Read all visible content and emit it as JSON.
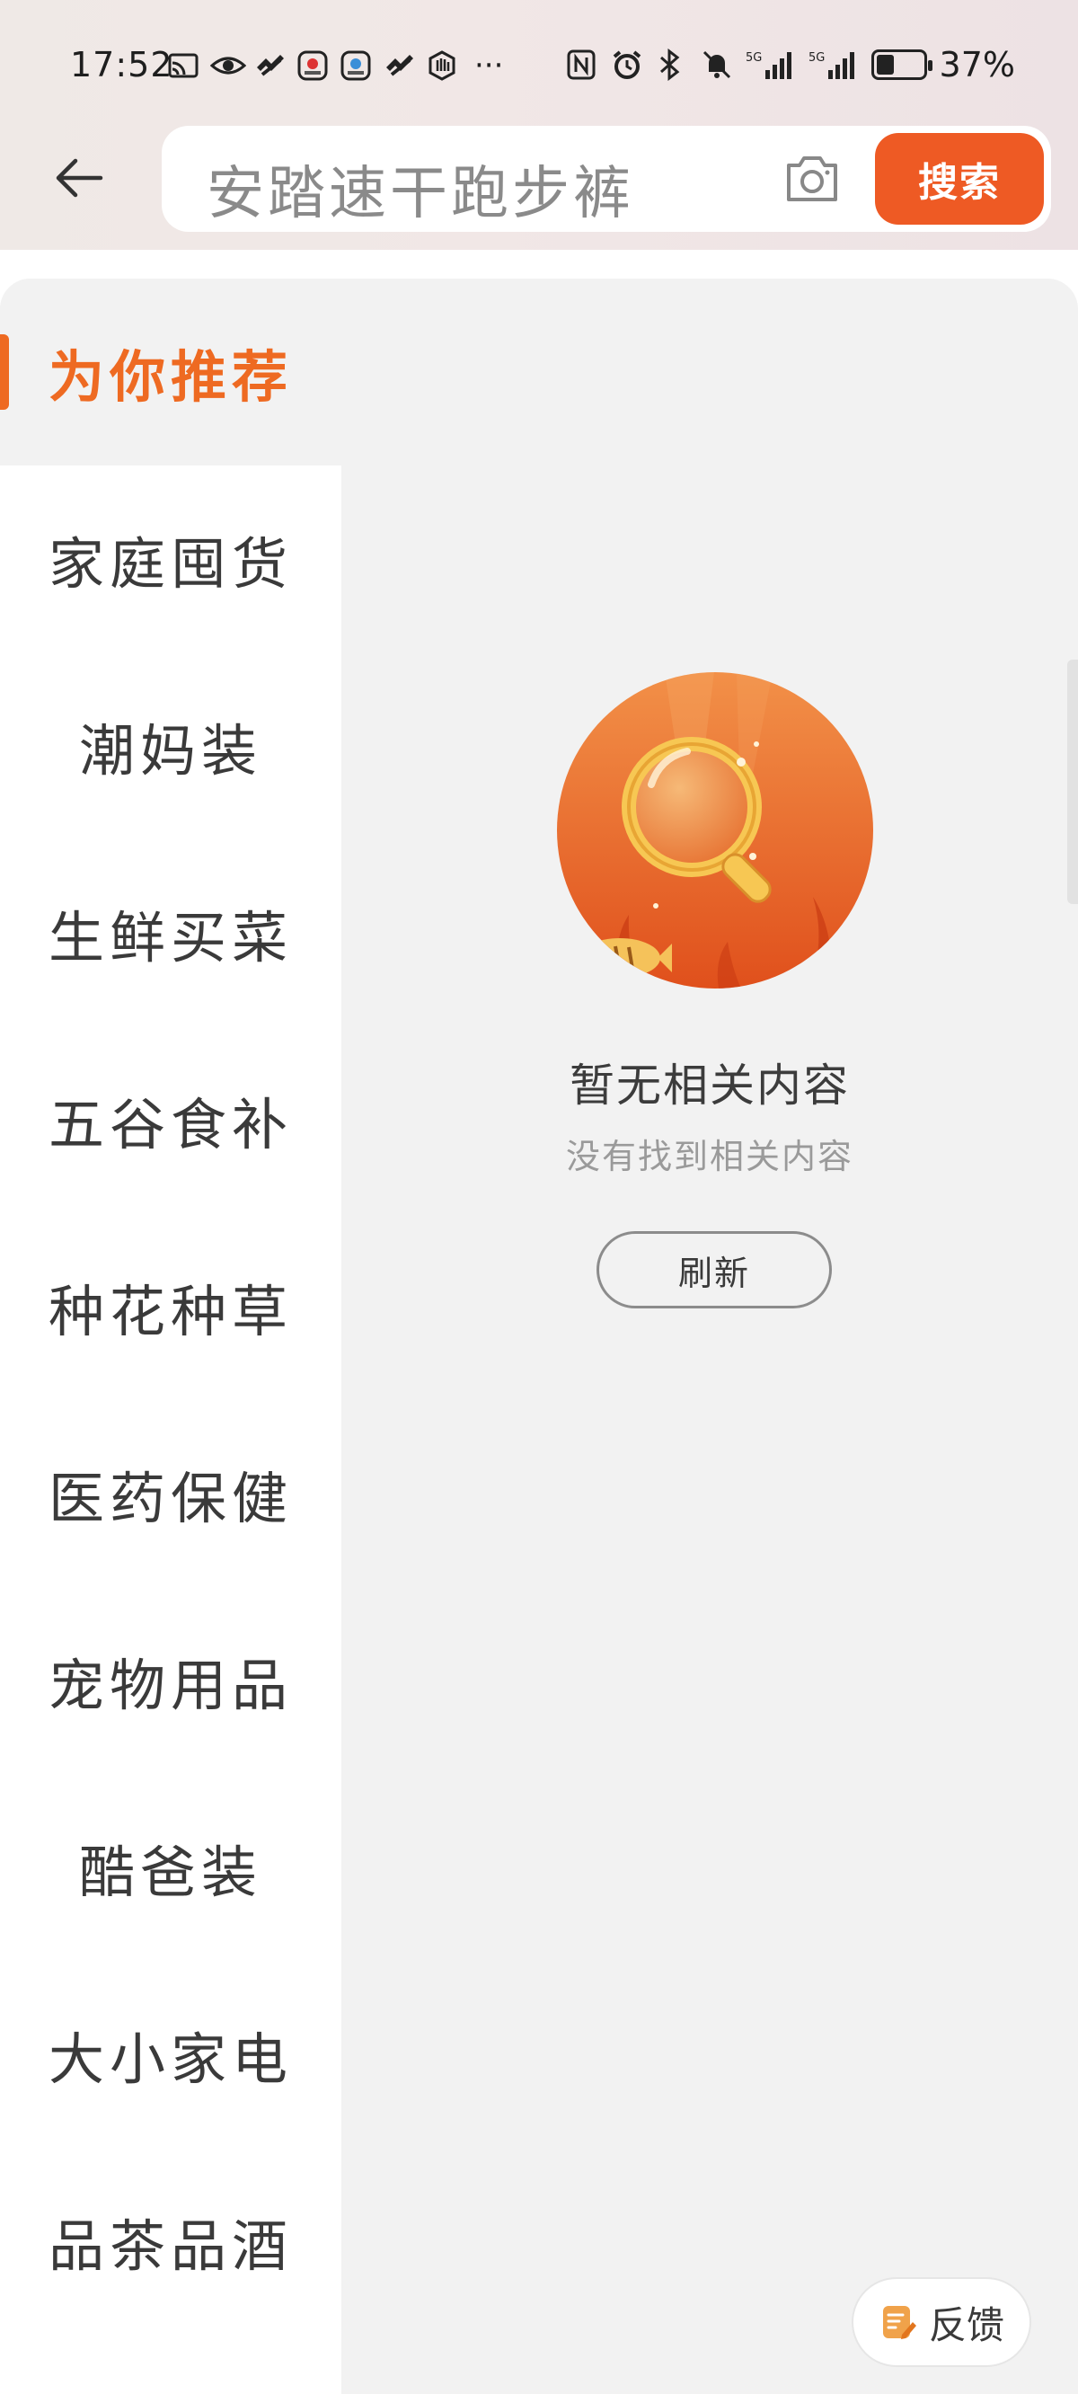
{
  "status_bar": {
    "time": "17:52",
    "battery_percent": "37%",
    "battery_level": 0.37,
    "left_icons": [
      "cast-icon",
      "eye-icon",
      "health-icon",
      "app-icon-1",
      "app-icon-2",
      "health-icon-2",
      "hand-icon"
    ],
    "more": "···"
  },
  "header": {
    "search_text": "安踏速干跑步裤",
    "search_button": "搜索"
  },
  "sidebar": {
    "items": [
      {
        "label": "为你推荐",
        "active": true
      },
      {
        "label": "家庭囤货",
        "active": false
      },
      {
        "label": "潮妈装",
        "active": false
      },
      {
        "label": "生鲜买菜",
        "active": false
      },
      {
        "label": "五谷食补",
        "active": false
      },
      {
        "label": "种花种草",
        "active": false
      },
      {
        "label": "医药保健",
        "active": false
      },
      {
        "label": "宠物用品",
        "active": false
      },
      {
        "label": "酷爸装",
        "active": false
      },
      {
        "label": "大小家电",
        "active": false
      },
      {
        "label": "品茶品酒",
        "active": false
      }
    ]
  },
  "empty_state": {
    "title": "暂无相关内容",
    "subtitle": "没有找到相关内容",
    "refresh_button": "刷新"
  },
  "feedback": {
    "label": "反馈"
  },
  "colors": {
    "accent": "#ee5a24",
    "active_text": "#ee6a22",
    "background": "#f2f2f2"
  }
}
